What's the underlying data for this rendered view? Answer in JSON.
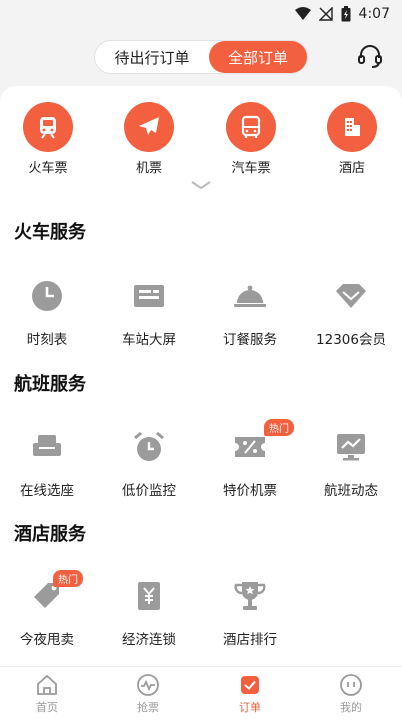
{
  "status_bar": {
    "time": "4:07"
  },
  "header": {
    "tabs": [
      {
        "label": "待出行订单",
        "active": false
      },
      {
        "label": "全部订单",
        "active": true
      }
    ]
  },
  "categories": [
    {
      "label": "火车票",
      "icon": "train-icon"
    },
    {
      "label": "机票",
      "icon": "airplane-icon"
    },
    {
      "label": "汽车票",
      "icon": "bus-icon"
    },
    {
      "label": "酒店",
      "icon": "hotel-icon"
    }
  ],
  "sections": [
    {
      "title": "火车服务",
      "items": [
        {
          "label": "时刻表",
          "icon": "clock-icon"
        },
        {
          "label": "车站大屏",
          "icon": "station-board-icon"
        },
        {
          "label": "订餐服务",
          "icon": "meal-cloche-icon"
        },
        {
          "label": "12306会员",
          "icon": "diamond-icon"
        }
      ]
    },
    {
      "title": "航班服务",
      "items": [
        {
          "label": "在线选座",
          "icon": "seat-icon"
        },
        {
          "label": "低价监控",
          "icon": "alarm-clock-icon"
        },
        {
          "label": "特价机票",
          "icon": "discount-ticket-icon",
          "badge": "热门"
        },
        {
          "label": "航班动态",
          "icon": "monitor-chart-icon"
        }
      ]
    },
    {
      "title": "酒店服务",
      "items": [
        {
          "label": "今夜甩卖",
          "icon": "tag-icon",
          "badge": "热门"
        },
        {
          "label": "经济连锁",
          "icon": "yen-doc-icon"
        },
        {
          "label": "酒店排行",
          "icon": "trophy-icon"
        }
      ]
    }
  ],
  "tabbar": [
    {
      "label": "首页",
      "icon": "home-icon",
      "active": false
    },
    {
      "label": "抢票",
      "icon": "pulse-icon",
      "active": false
    },
    {
      "label": "订单",
      "icon": "order-check-icon",
      "active": true
    },
    {
      "label": "我的",
      "icon": "profile-icon",
      "active": false
    }
  ],
  "colors": {
    "accent": "#f2603f",
    "icon_gray": "#9b9b9b",
    "inactive_tab": "#9a9a9a"
  }
}
